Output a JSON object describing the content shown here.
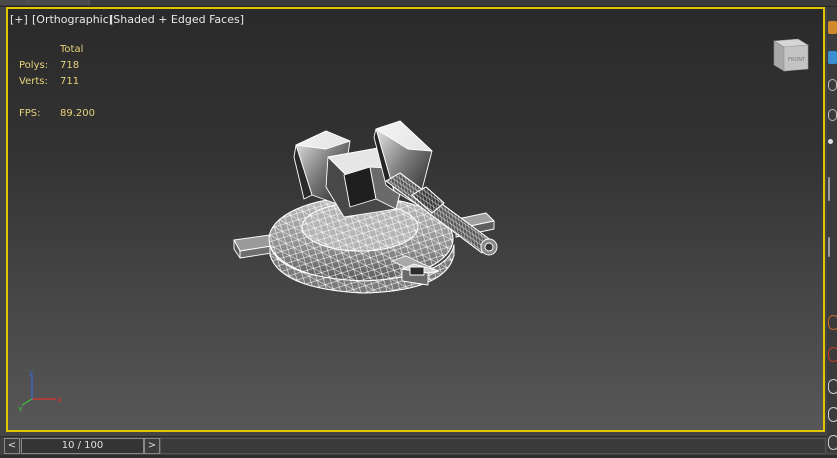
{
  "viewport": {
    "menu_plus": "[+]",
    "menu_view": "[Orthographic]",
    "menu_shading": "[Shaded + Edged Faces]",
    "active_border_color": "#e0c600"
  },
  "stats": {
    "total_header": "Total",
    "polys_label": "Polys:",
    "polys_value": "718",
    "verts_label": "Verts:",
    "verts_value": "711",
    "fps_label": "FPS:",
    "fps_value": "89.200",
    "color": "#e6d27a"
  },
  "viewcube": {
    "face_label": "FRONT",
    "icon": "viewcube-icon"
  },
  "axis_gizmo": {
    "x": "x",
    "y": "y",
    "z": "z"
  },
  "timeline": {
    "prev_label": "<",
    "next_label": ">",
    "frame_text": "10 / 100",
    "current_frame": 10,
    "total_frames": 100
  }
}
